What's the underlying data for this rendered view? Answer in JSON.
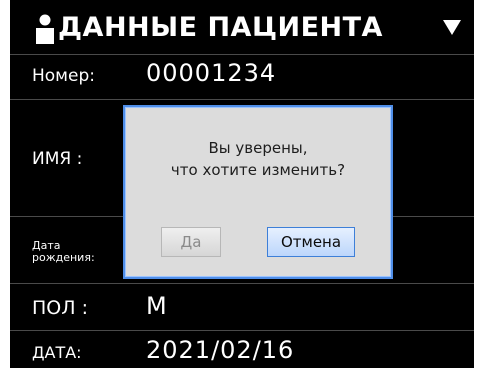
{
  "header": {
    "title": "ДАННЫЕ ПАЦИЕНТА",
    "icon": "person-icon",
    "menu_icon": "dropdown-arrow-icon"
  },
  "fields": [
    {
      "label": "Номер:",
      "value": "00001234"
    },
    {
      "label": "ИМЯ :",
      "value": ""
    },
    {
      "label": "Дата\nрождения:",
      "value": ""
    },
    {
      "label": "ПОЛ :",
      "value": "M"
    },
    {
      "label": "ДАТА:",
      "value": "2021/02/16"
    }
  ],
  "dialog": {
    "message_line1": "Вы уверены,",
    "message_line2": "что хотите изменить?",
    "yes_label": "Да",
    "cancel_label": "Отмена",
    "yes_enabled": false
  },
  "colors": {
    "background": "#000000",
    "text": "#ffffff",
    "dialog_border": "#4f8ee8",
    "cancel_button": "#bcd6fb"
  }
}
